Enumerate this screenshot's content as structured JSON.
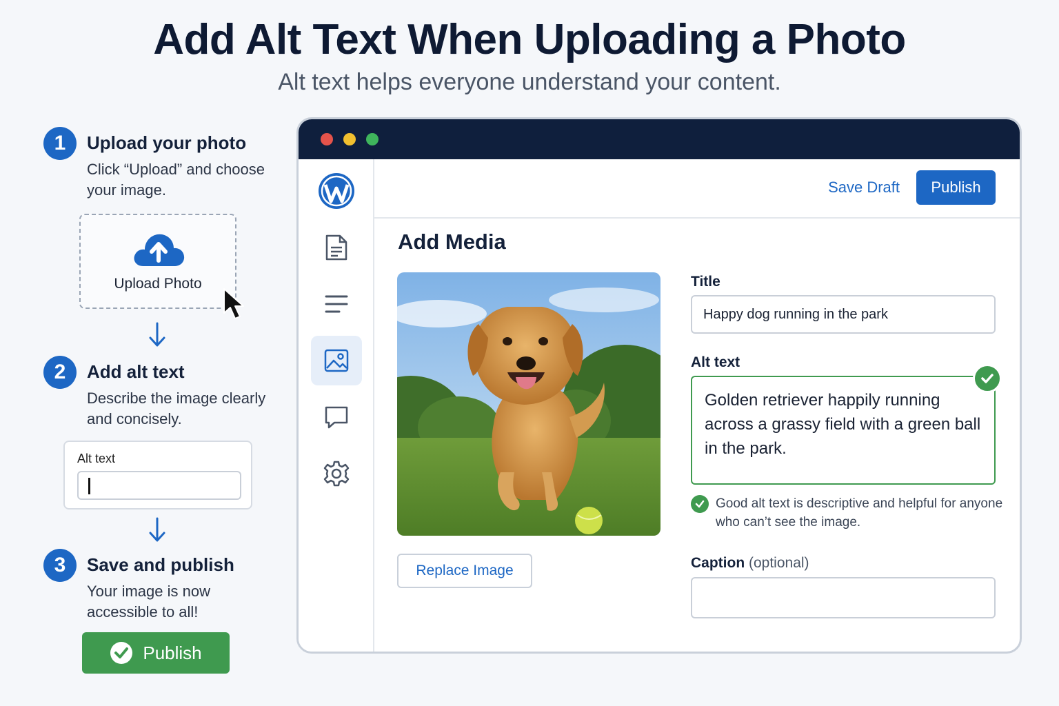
{
  "header": {
    "title": "Add Alt Text When Uploading a Photo",
    "subtitle": "Alt text helps everyone understand your content."
  },
  "steps": [
    {
      "number": "1",
      "title": "Upload your photo",
      "description": "Click “Upload” and choose your image."
    },
    {
      "number": "2",
      "title": "Add alt text",
      "description": "Describe the image clearly and concisely."
    },
    {
      "number": "3",
      "title": "Save and publish",
      "description": "Your image is now accessible to all!"
    }
  ],
  "upload_box": {
    "label": "Upload Photo",
    "icon": "cloud-upload-icon"
  },
  "alt_card": {
    "label": "Alt text",
    "value": ""
  },
  "green_publish": {
    "label": "Publish",
    "icon": "check-circle-icon"
  },
  "window": {
    "sidebar": [
      {
        "icon": "wordpress-logo-icon",
        "active": false
      },
      {
        "icon": "document-icon",
        "active": false
      },
      {
        "icon": "menu-lines-icon",
        "active": false
      },
      {
        "icon": "image-icon",
        "active": true
      },
      {
        "icon": "comment-icon",
        "active": false
      },
      {
        "icon": "gear-icon",
        "active": false
      }
    ],
    "topbar": {
      "save_draft": "Save Draft",
      "publish": "Publish"
    },
    "panel": {
      "heading": "Add Media",
      "replace_button": "Replace Image",
      "title_label": "Title",
      "title_value": "Happy dog running in the park",
      "alt_label": "Alt text",
      "alt_value": "Golden retriever happily running across a grassy field with a green ball in the park.",
      "hint": "Good alt text is descriptive and helpful for anyone who can’t see the image.",
      "caption_label": "Caption",
      "caption_optional": "(optional)",
      "caption_value": ""
    }
  },
  "colors": {
    "primary": "#1d67c4",
    "success": "#3f9a4f",
    "titlebar": "#0f1f3d"
  }
}
